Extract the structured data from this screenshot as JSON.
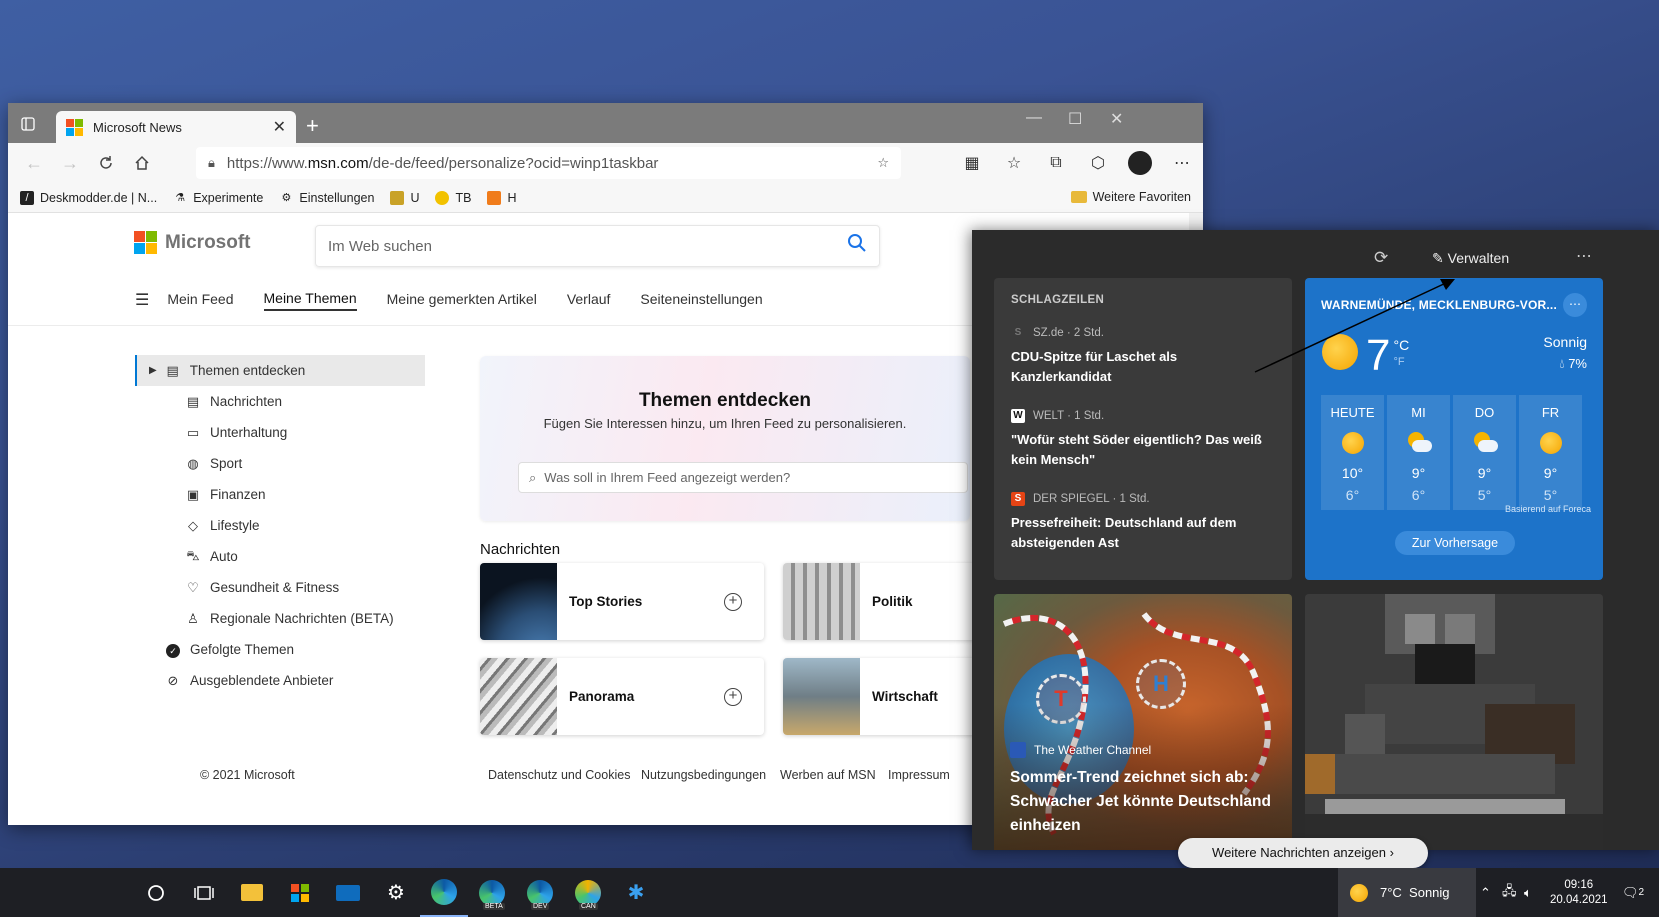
{
  "browser": {
    "tab_title": "Microsoft News",
    "url_prefix": "https://www.",
    "url_domain": "msn.com",
    "url_path": "/de-de/feed/personalize?ocid=winp1taskbar",
    "favorites": [
      {
        "label": "Deskmodder.de | N...",
        "icon": "deskmodder-icon"
      },
      {
        "label": "Experimente",
        "icon": "flask-icon"
      },
      {
        "label": "Einstellungen",
        "icon": "gear-icon"
      },
      {
        "label": "U",
        "icon": "ext-u-icon"
      },
      {
        "label": "TB",
        "icon": "ext-tb-icon"
      },
      {
        "label": "H",
        "icon": "ext-h-icon"
      }
    ],
    "more_favorites": "Weitere Favoriten"
  },
  "msn": {
    "brand": "Microsoft",
    "search_placeholder": "Im Web suchen",
    "nav": [
      "Mein Feed",
      "Meine Themen",
      "Meine gemerkten Artikel",
      "Verlauf",
      "Seiteneinstellungen"
    ],
    "sidebar": [
      {
        "label": "Themen entdecken",
        "icon": "discover-icon"
      },
      {
        "label": "Nachrichten",
        "icon": "newspaper-icon"
      },
      {
        "label": "Unterhaltung",
        "icon": "tv-icon"
      },
      {
        "label": "Sport",
        "icon": "ball-icon"
      },
      {
        "label": "Finanzen",
        "icon": "money-icon"
      },
      {
        "label": "Lifestyle",
        "icon": "diamond-icon"
      },
      {
        "label": "Auto",
        "icon": "car-icon"
      },
      {
        "label": "Gesundheit & Fitness",
        "icon": "heart-icon"
      },
      {
        "label": "Regionale Nachrichten (BETA)",
        "icon": "person-pin-icon"
      },
      {
        "label": "Gefolgte Themen",
        "icon": "check-circle-icon"
      },
      {
        "label": "Ausgeblendete Anbieter",
        "icon": "block-icon"
      }
    ],
    "discover_title": "Themen entdecken",
    "discover_subtitle": "Fügen Sie Interessen hinzu, um Ihren Feed zu personalisieren.",
    "discover_placeholder": "Was soll in Ihrem Feed angezeigt werden?",
    "section_title": "Nachrichten",
    "topics": [
      "Top Stories",
      "Politik",
      "Panorama",
      "Wirtschaft"
    ],
    "footer": {
      "copyright": "© 2021 Microsoft",
      "links": [
        "Datenschutz und Cookies",
        "Nutzungsbedingungen",
        "Werben auf MSN",
        "Impressum"
      ]
    }
  },
  "widgets": {
    "manage": "Verwalten",
    "headlines_title": "SCHLAGZEILEN",
    "news": [
      {
        "source": "SZ.de · 2 Std.",
        "headline": "CDU-Spitze für Laschet als Kanzlerkandidat",
        "logo": "SZ",
        "color": "#3a3a3a"
      },
      {
        "source": "WELT · 1 Std.",
        "headline": "\"Wofür steht Söder eigentlich? Das weiß kein Mensch\"",
        "logo": "W",
        "color": "#111111"
      },
      {
        "source": "DER SPIEGEL · 1 Std.",
        "headline": "Pressefreiheit: Deutschland auf dem absteigenden Ast",
        "logo": "S",
        "color": "#e64415"
      }
    ],
    "weather": {
      "location": "WARNEMÜNDE, MECKLENBURG-VOR...",
      "temp": "7",
      "unit_c": "°C",
      "unit_f": "°F",
      "condition": "Sonnig",
      "precip": "7%",
      "days": [
        {
          "name": "HEUTE",
          "hi": "10°",
          "lo": "6°",
          "icon": "sun-icon"
        },
        {
          "name": "MI",
          "hi": "9°",
          "lo": "6°",
          "icon": "partly-cloudy-icon"
        },
        {
          "name": "DO",
          "hi": "9°",
          "lo": "5°",
          "icon": "partly-cloudy-icon"
        },
        {
          "name": "FR",
          "hi": "9°",
          "lo": "5°",
          "icon": "sun-icon"
        }
      ],
      "based_on": "Basierend auf Foreca",
      "forecast_button": "Zur Vorhersage"
    },
    "story": {
      "source": "The Weather Channel",
      "title": "Sommer-Trend zeichnet sich ab: Schwacher Jet könnte Deutschland einheizen"
    },
    "more_news": "Weitere Nachrichten anzeigen"
  },
  "taskbar": {
    "weather": "7°C  Sonnig",
    "time": "09:16",
    "date": "20.04.2021",
    "notifications": "2",
    "edge_badges": [
      "",
      "BETA",
      "DEV",
      "CAN"
    ]
  },
  "colors": {
    "ms_red": "#f25022",
    "ms_green": "#7fba00",
    "ms_blue": "#00a4ef",
    "ms_yellow": "#ffb900",
    "weather_bg": "#1d73c9",
    "widget_bg": "#2b2b2b",
    "accent": "#0078d4"
  }
}
